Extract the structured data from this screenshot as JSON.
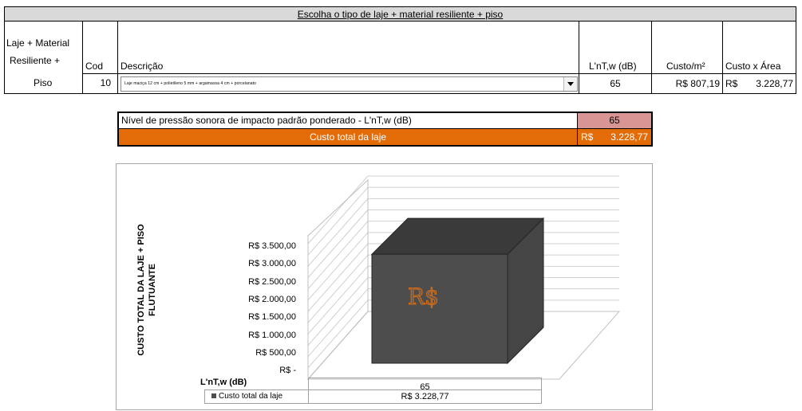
{
  "table": {
    "title": "Escolha o tipo de laje + material resiliente + piso",
    "row_header_lines": [
      "Laje + Material",
      "Resiliente +",
      "Piso"
    ],
    "col_cod": "Cod",
    "col_descricao": "Descrição",
    "col_lntw": "L'nT,w (dB)",
    "col_custo_m2": "Custo/m²",
    "col_custo_area": "Custo x Área",
    "row": {
      "cod": "10",
      "descricao": "Laje maciça 12 cm + polietileno 5 mm + argamassa 4 cm + porcelanato",
      "lntw": "65",
      "custo_m2": "R$ 807,19",
      "custo_area_currency": "R$",
      "custo_area_value": "3.228,77"
    }
  },
  "summary": {
    "nivel_label": "Nível de pressão sonora de impacto padrão ponderado - L'nT,w (dB)",
    "nivel_value": "65",
    "custo_label": "Custo total da laje",
    "custo_currency": "R$",
    "custo_value": "3.228,77",
    "colors": {
      "nivel_value_bg": "#d99594",
      "custo_bg": "#e36c09"
    }
  },
  "chart_data": {
    "type": "bar",
    "categories": [
      "65"
    ],
    "series": [
      {
        "name": "Custo total da laje",
        "values": [
          3228.77
        ]
      }
    ],
    "ylabel": "CUSTO TOTAL DA LAJE + PISO FLUTUANTE",
    "ylabel_lines": [
      "CUSTO TOTAL DA LAJE + PISO",
      "FLUTUANTE"
    ],
    "xlabel": "L'nT,w (dB)",
    "ylim": [
      0,
      3500
    ],
    "yticks": [
      "R$ 3.500,00",
      "R$ 3.000,00",
      "R$ 2.500,00",
      "R$ 2.000,00",
      "R$ 1.500,00",
      "R$ 1.000,00",
      "R$ 500,00",
      "R$ -"
    ],
    "table_row_label": "Custo total da laje",
    "table_row_value": "R$ 3.228,77",
    "bar_logo_text": "R$",
    "grid": true,
    "style_3d": true,
    "bar_color": "#4d4d4d"
  }
}
